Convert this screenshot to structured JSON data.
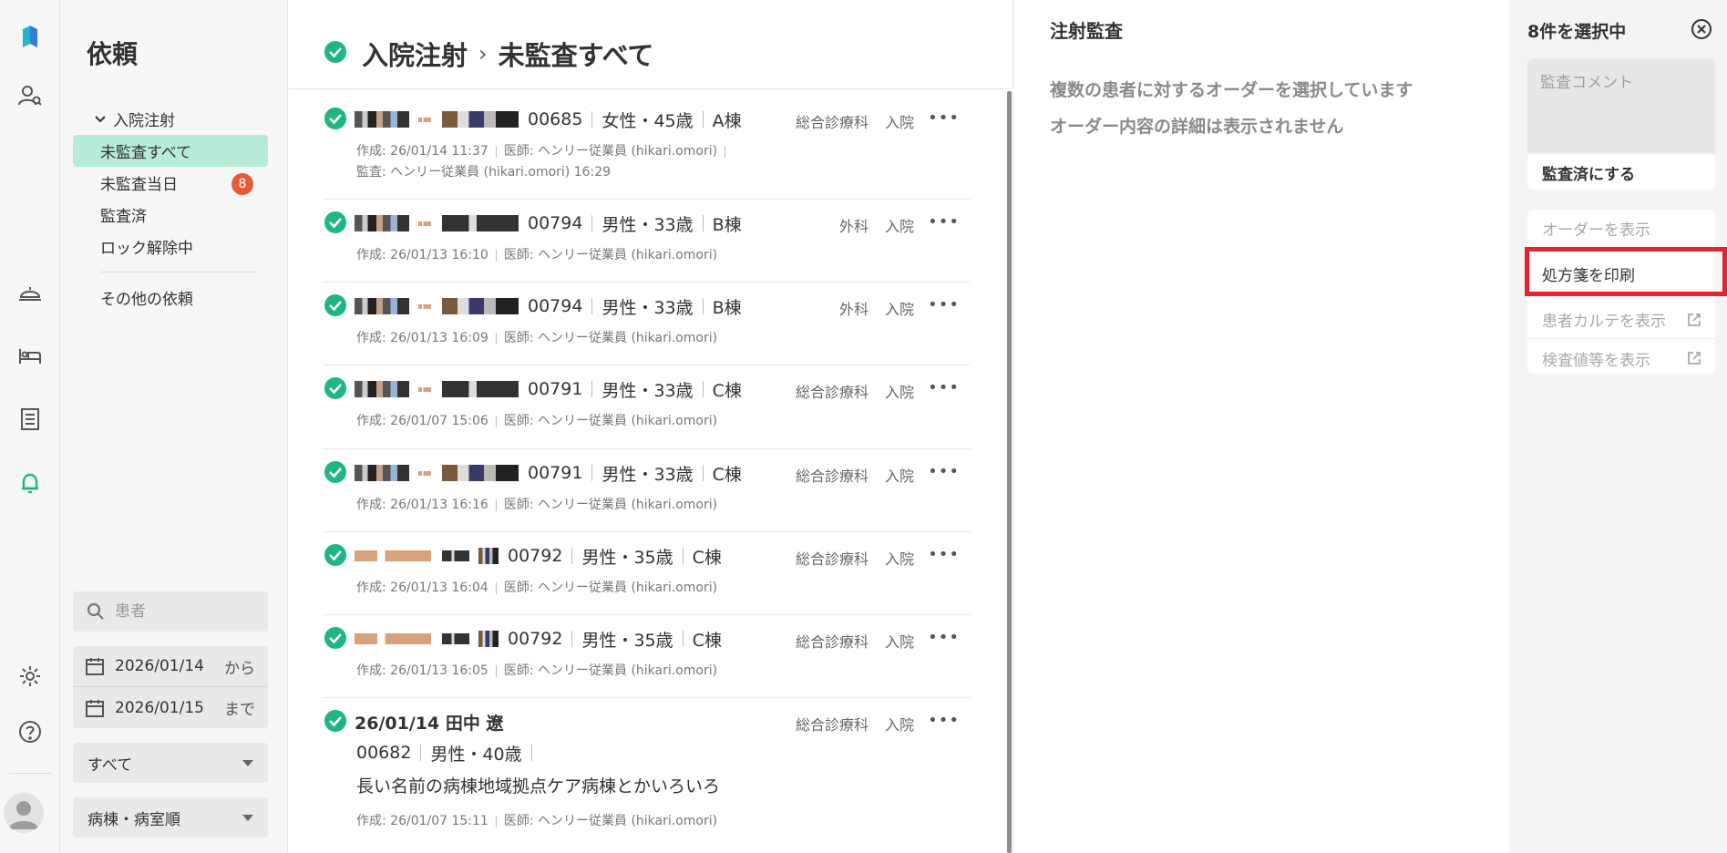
{
  "nav": {
    "title": "依頼",
    "group_label": "入院注射",
    "items": [
      {
        "label": "未監査すべて",
        "active": true
      },
      {
        "label": "未監査当日",
        "badge": "8"
      },
      {
        "label": "監査済"
      },
      {
        "label": "ロック解除中"
      }
    ],
    "other_label": "その他の依頼",
    "search_placeholder": "患者",
    "date_from": "2026/01/14",
    "date_from_suffix": "から",
    "date_to": "2026/01/15",
    "date_to_suffix": "まで",
    "filter_value": "すべて",
    "sort_value": "病棟・病室順"
  },
  "list": {
    "title_part1": "入院注射",
    "title_part2": "未監査すべて",
    "rows": [
      {
        "pid": "00685",
        "sex_age": "女性・45歳",
        "ward": "A棟",
        "dept": "総合診療科",
        "type": "入院",
        "meta": "作成: 26/01/14 11:37",
        "doctor": "医師: ヘンリー従業員 (hikari.omori)",
        "audit": "監査: ヘンリー従業員 (hikari.omori) 16:29"
      },
      {
        "pid": "00794",
        "sex_age": "男性・33歳",
        "ward": "B棟",
        "dept": "外科",
        "type": "入院",
        "meta": "作成: 26/01/13 16:10",
        "doctor": "医師: ヘンリー従業員 (hikari.omori)"
      },
      {
        "pid": "00794",
        "sex_age": "男性・33歳",
        "ward": "B棟",
        "dept": "外科",
        "type": "入院",
        "meta": "作成: 26/01/13 16:09",
        "doctor": "医師: ヘンリー従業員 (hikari.omori)"
      },
      {
        "pid": "00791",
        "sex_age": "男性・33歳",
        "ward": "C棟",
        "dept": "総合診療科",
        "type": "入院",
        "meta": "作成: 26/01/07 15:06",
        "doctor": "医師: ヘンリー従業員 (hikari.omori)"
      },
      {
        "pid": "00791",
        "sex_age": "男性・33歳",
        "ward": "C棟",
        "dept": "総合診療科",
        "type": "入院",
        "meta": "作成: 26/01/13 16:16",
        "doctor": "医師: ヘンリー従業員 (hikari.omori)"
      },
      {
        "pid": "00792",
        "sex_age": "男性・35歳",
        "ward": "C棟",
        "dept": "総合診療科",
        "type": "入院",
        "meta": "作成: 26/01/13 16:04",
        "doctor": "医師: ヘンリー従業員 (hikari.omori)"
      },
      {
        "pid": "00792",
        "sex_age": "男性・35歳",
        "ward": "C棟",
        "dept": "総合診療科",
        "type": "入院",
        "meta": "作成: 26/01/13 16:05",
        "doctor": "医師: ヘンリー従業員 (hikari.omori)"
      },
      {
        "name": "26/01/14 田中 遼",
        "pid": "00682",
        "sex_age": "男性・40歳",
        "ward_long": "長い名前の病棟地域拠点ケア病棟とかいろいろ",
        "dept": "総合診療科",
        "type": "入院",
        "meta": "作成: 26/01/07 15:11",
        "doctor": "医師: ヘンリー従業員 (hikari.omori)"
      }
    ],
    "more_label": "•••"
  },
  "detail": {
    "title": "注射監査",
    "msg1": "複数の患者に対するオーダーを選択しています",
    "msg2": "オーダー内容の詳細は表示されません"
  },
  "actions": {
    "selected": "8件を選択中",
    "comment_placeholder": "監査コメント",
    "audit_button": "監査済にする",
    "show_order": "オーダーを表示",
    "print_rx": "処方箋を印刷",
    "show_chart": "患者カルテを表示",
    "show_labs": "検査値等を表示"
  },
  "colors": {
    "accent": "#1fb77f",
    "badge": "#e85a34",
    "highlight": "#e8232d",
    "active_bg": "#b6ecd7"
  },
  "icons": [
    "logo-icon",
    "patient-search-icon",
    "bell-service-icon",
    "bed-icon",
    "receipt-icon",
    "bell-icon",
    "gear-icon",
    "help-icon",
    "avatar-icon",
    "search-icon",
    "calendar-icon",
    "check-circle-icon",
    "close-circle-icon",
    "external-link-icon"
  ]
}
